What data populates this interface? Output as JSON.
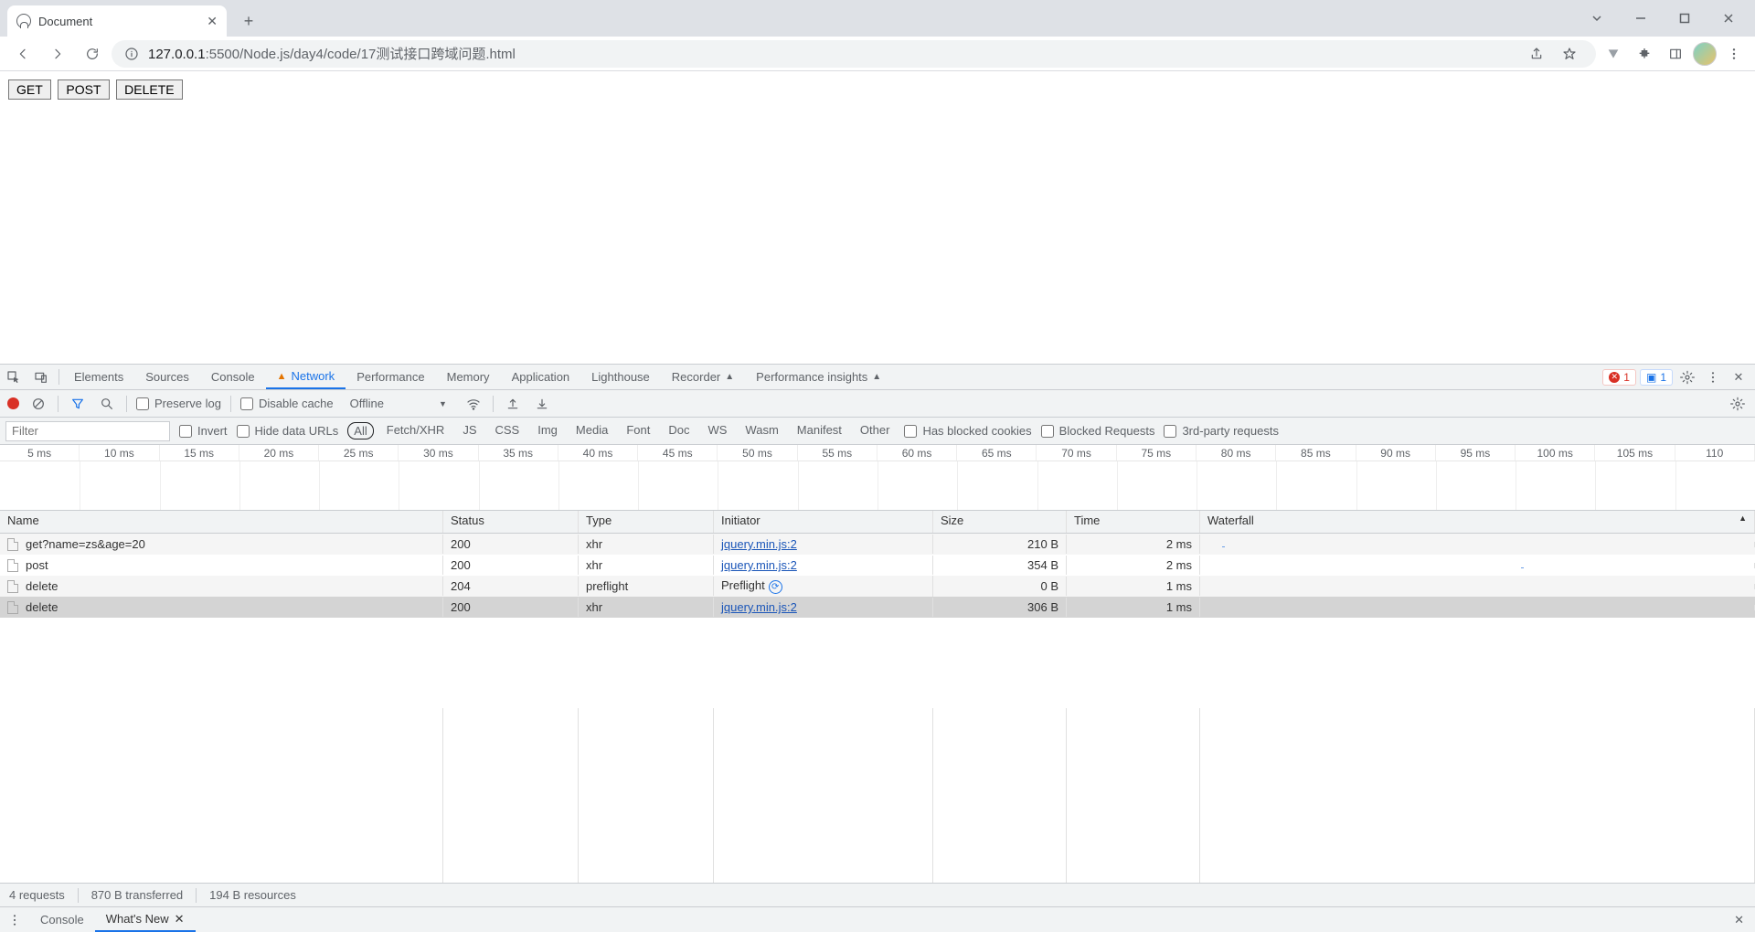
{
  "browser": {
    "tab_title": "Document",
    "url_host": "127.0.0.1",
    "url_port": ":5500",
    "url_path": "/Node.js/day4/code/17测试接口跨域问题.html"
  },
  "page": {
    "buttons": [
      "GET",
      "POST",
      "DELETE"
    ]
  },
  "devtools": {
    "tabs": [
      "Elements",
      "Sources",
      "Console",
      "Network",
      "Performance",
      "Memory",
      "Application",
      "Lighthouse",
      "Recorder",
      "Performance insights"
    ],
    "active_tab": "Network",
    "error_count": "1",
    "info_count": "1",
    "toolbar": {
      "preserve_log": "Preserve log",
      "disable_cache": "Disable cache",
      "throttle": "Offline"
    },
    "filter": {
      "placeholder": "Filter",
      "invert": "Invert",
      "hide_data_urls": "Hide data URLs",
      "types": [
        "All",
        "Fetch/XHR",
        "JS",
        "CSS",
        "Img",
        "Media",
        "Font",
        "Doc",
        "WS",
        "Wasm",
        "Manifest",
        "Other"
      ],
      "active_type": "All",
      "blocked_cookies": "Has blocked cookies",
      "blocked_requests": "Blocked Requests",
      "third_party": "3rd-party requests"
    },
    "timeline_ticks": [
      "5 ms",
      "10 ms",
      "15 ms",
      "20 ms",
      "25 ms",
      "30 ms",
      "35 ms",
      "40 ms",
      "45 ms",
      "50 ms",
      "55 ms",
      "60 ms",
      "65 ms",
      "70 ms",
      "75 ms",
      "80 ms",
      "85 ms",
      "90 ms",
      "95 ms",
      "100 ms",
      "105 ms",
      "110"
    ],
    "columns": {
      "name": "Name",
      "status": "Status",
      "type": "Type",
      "initiator": "Initiator",
      "size": "Size",
      "time": "Time",
      "waterfall": "Waterfall"
    },
    "rows": [
      {
        "name": "get?name=zs&age=20",
        "status": "200",
        "type": "xhr",
        "initiator": "jquery.min.js:2",
        "initiator_link": true,
        "size": "210 B",
        "time": "2 ms",
        "wf_left": "4%"
      },
      {
        "name": "post",
        "status": "200",
        "type": "xhr",
        "initiator": "jquery.min.js:2",
        "initiator_link": true,
        "size": "354 B",
        "time": "2 ms",
        "wf_left": "58%"
      },
      {
        "name": "delete",
        "status": "204",
        "type": "preflight",
        "initiator": "Preflight",
        "initiator_link": false,
        "preflight_icon": true,
        "size": "0 B",
        "time": "1 ms",
        "wf_left": ""
      },
      {
        "name": "delete",
        "status": "200",
        "type": "xhr",
        "initiator": "jquery.min.js:2",
        "initiator_link": true,
        "size": "306 B",
        "time": "1 ms",
        "wf_left": "",
        "selected": true
      }
    ],
    "status": {
      "requests": "4 requests",
      "transferred": "870 B transferred",
      "resources": "194 B resources"
    },
    "drawer": {
      "console": "Console",
      "whatsnew": "What's New"
    }
  }
}
